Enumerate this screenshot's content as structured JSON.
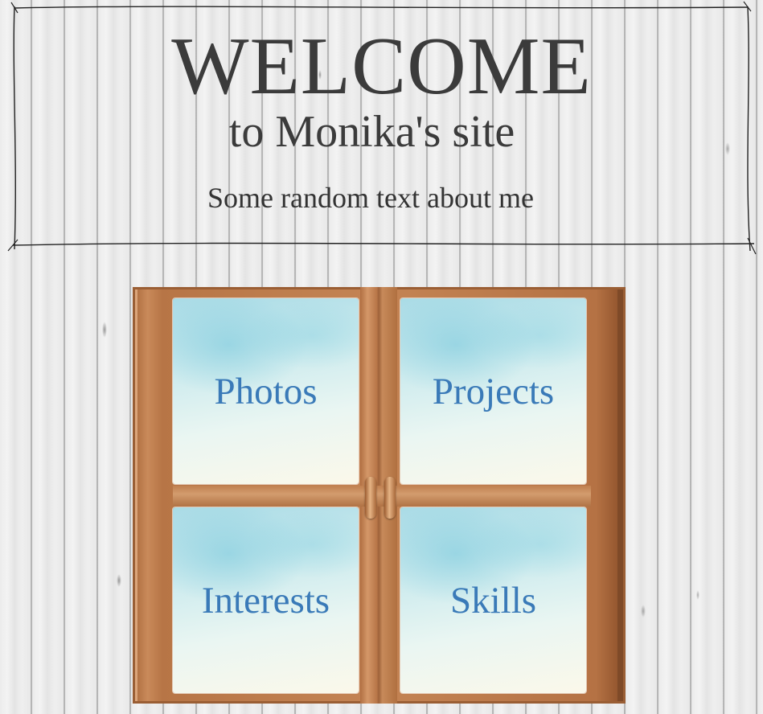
{
  "header": {
    "welcome": "WELCOME",
    "subtitle": "to Monika's site",
    "about": "Some random text about me"
  },
  "nav": {
    "items": [
      {
        "label": "Photos"
      },
      {
        "label": "Projects"
      },
      {
        "label": "Interests"
      },
      {
        "label": "Skills"
      }
    ]
  },
  "colors": {
    "link": "#3a7ab8",
    "heading": "#3b3b3b",
    "wood_frame": "#c48454",
    "background": "#e9e9e9"
  }
}
